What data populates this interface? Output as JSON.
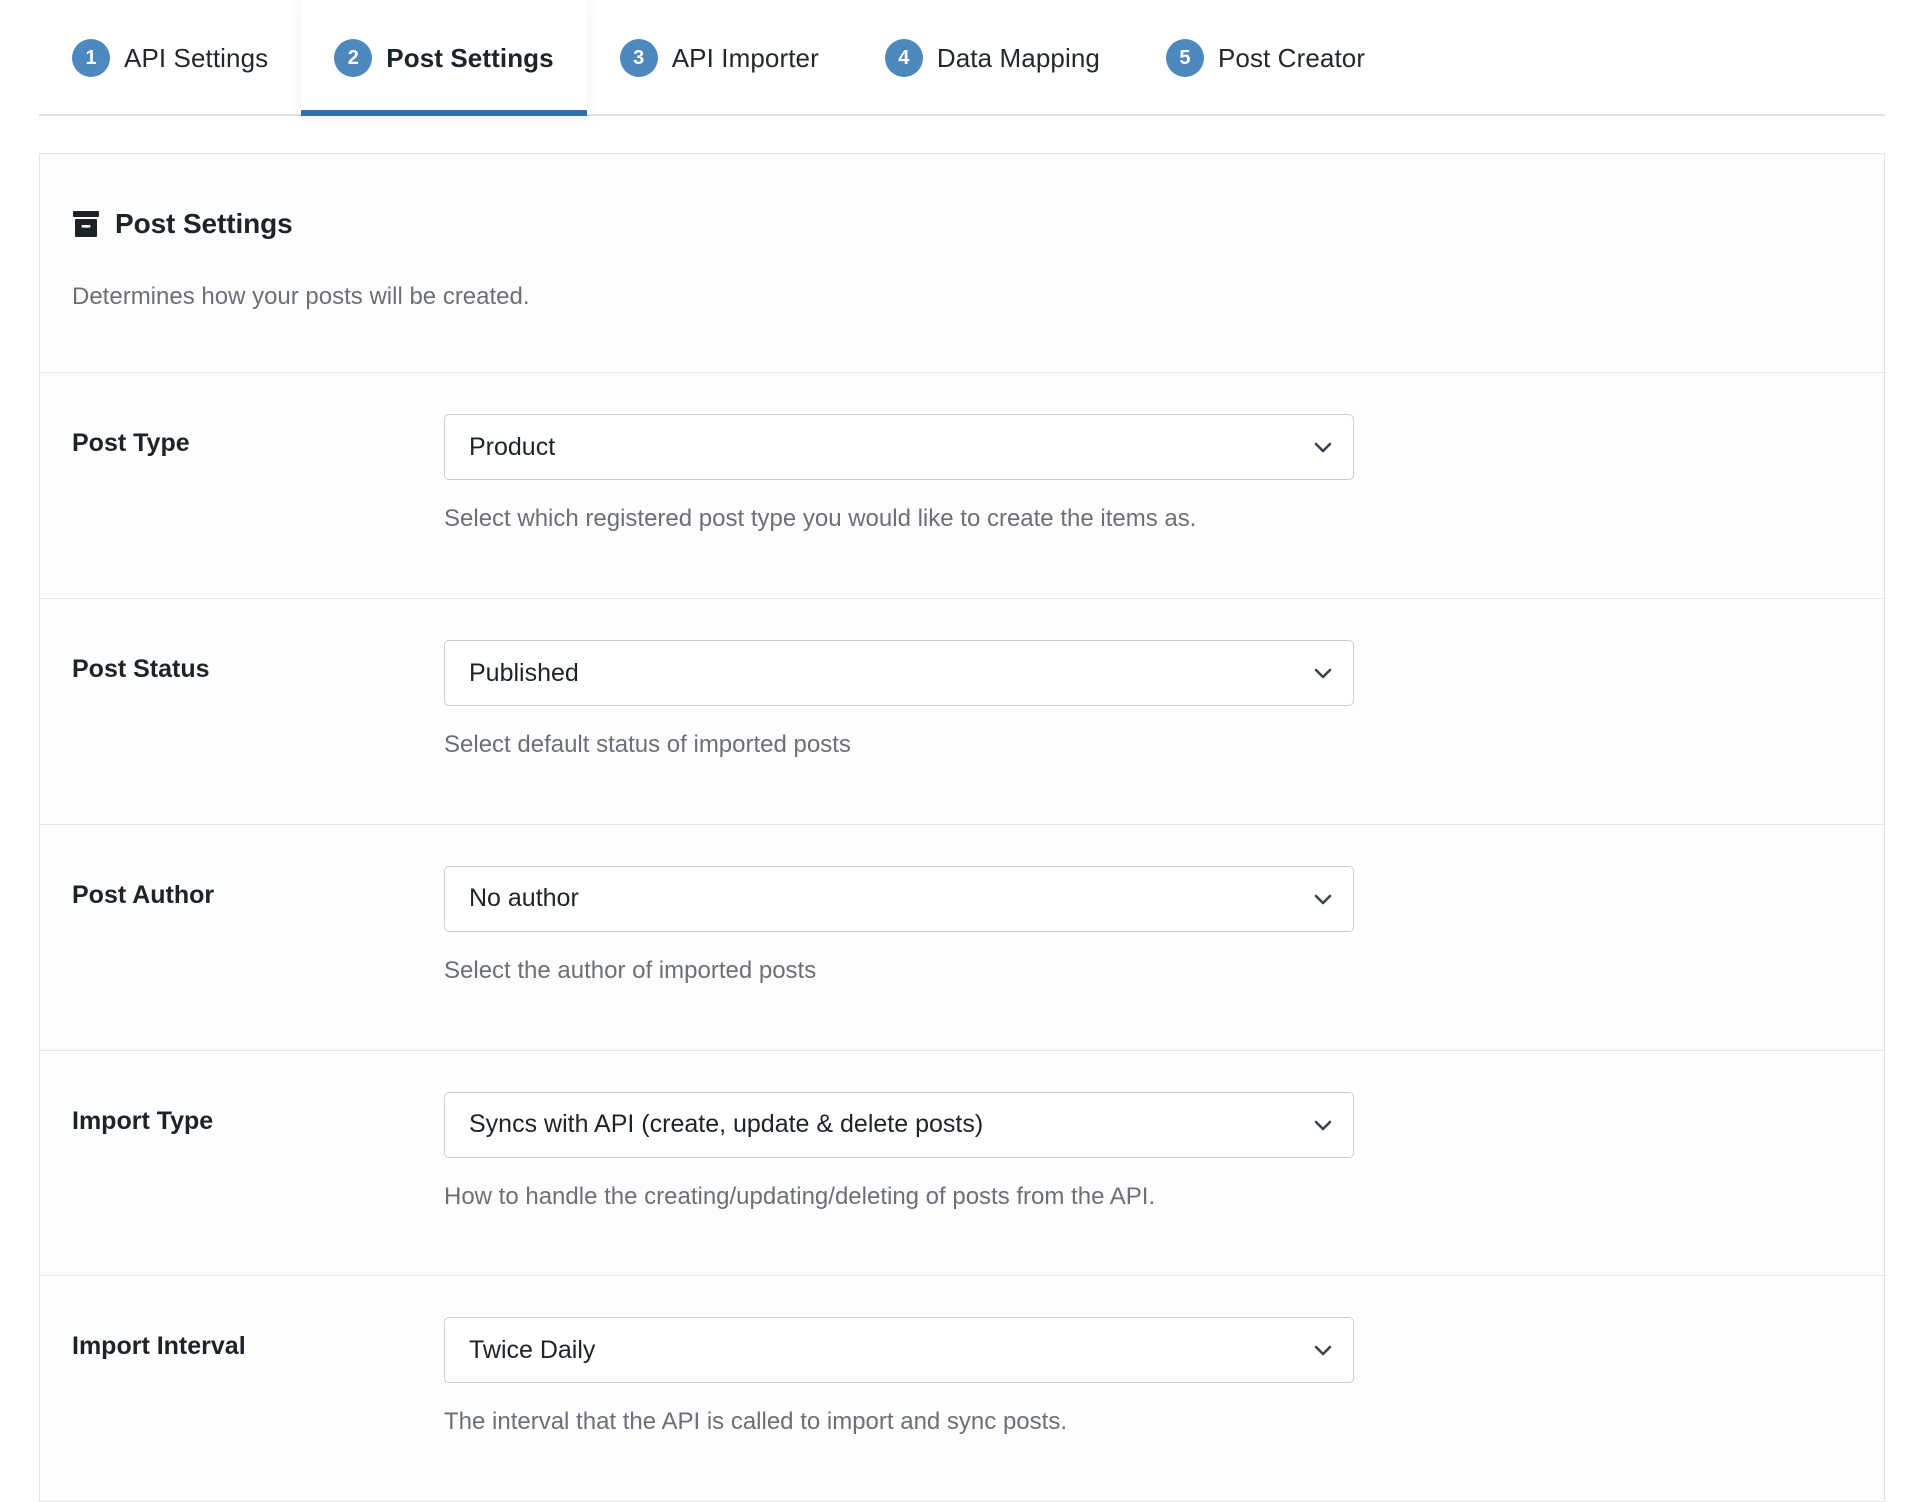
{
  "tabs": [
    {
      "number": "1",
      "label": "API Settings",
      "active": false
    },
    {
      "number": "2",
      "label": "Post Settings",
      "active": true
    },
    {
      "number": "3",
      "label": "API Importer",
      "active": false
    },
    {
      "number": "4",
      "label": "Data Mapping",
      "active": false
    },
    {
      "number": "5",
      "label": "Post Creator",
      "active": false
    }
  ],
  "card": {
    "icon": "archive-box-icon",
    "title": "Post Settings",
    "subtitle": "Determines how your posts will be created."
  },
  "rows": [
    {
      "label": "Post Type",
      "value": "Product",
      "help": "Select which registered post type you would like to create the items as.",
      "icon": "chevron-down-icon"
    },
    {
      "label": "Post Status",
      "value": "Published",
      "help": "Select default status of imported posts",
      "icon": "chevron-down-icon"
    },
    {
      "label": "Post Author",
      "value": "No author",
      "help": "Select the author of imported posts",
      "icon": "chevron-down-icon"
    },
    {
      "label": "Import Type",
      "value": "Syncs with API (create, update & delete posts)",
      "help": "How to handle the creating/updating/deleting of posts from the API.",
      "icon": "chevron-down-icon"
    },
    {
      "label": "Import Interval",
      "value": "Twice Daily",
      "help": "The interval that the API is called to import and sync posts.",
      "icon": "chevron-down-icon"
    }
  ],
  "colors": {
    "badge_blue": "#4d88bf",
    "active_underline": "#2e71ab",
    "border": "#e2e4e7",
    "divider": "#e4e6e8",
    "input_border": "#c9cfd8",
    "text_primary": "#1d2327",
    "text_muted": "#6c7076"
  }
}
